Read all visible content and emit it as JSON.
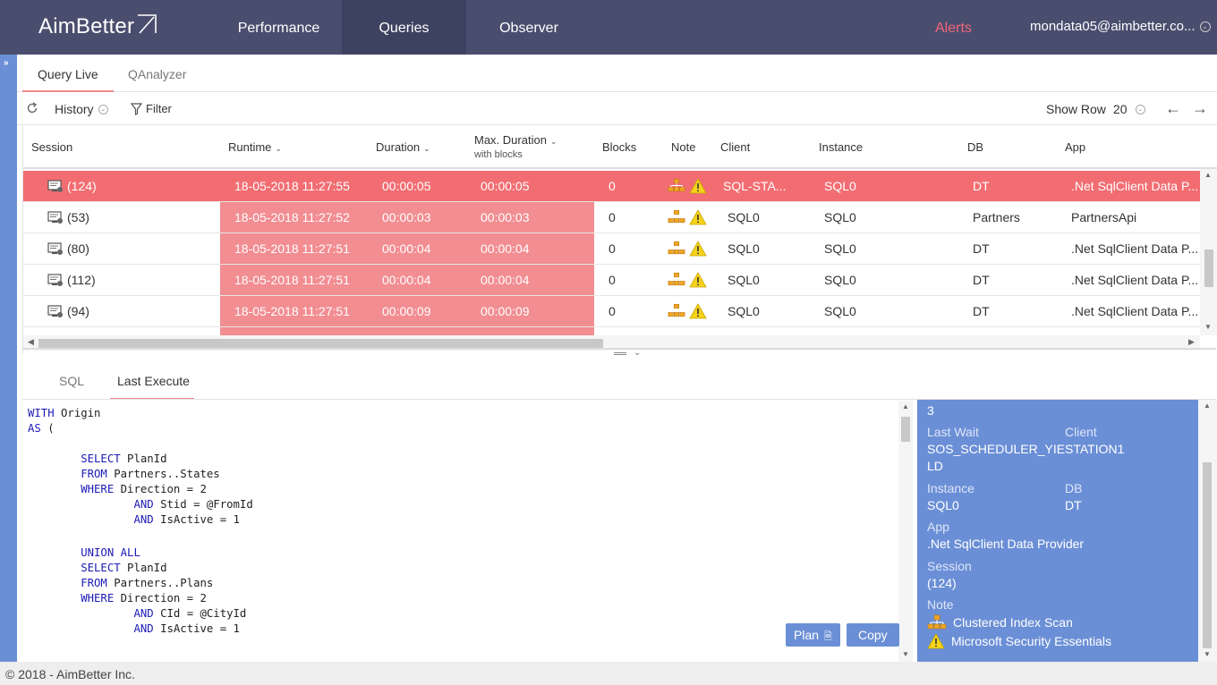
{
  "nav": {
    "logo": "AimBetter",
    "tabs": [
      "Performance",
      "Queries",
      "Observer"
    ],
    "alerts": "Alerts",
    "user": "mondata05@aimbetter.co..."
  },
  "subtabs": [
    "Query Live",
    "QAnalyzer"
  ],
  "toolbar": {
    "history": "History",
    "filter": "Filter",
    "show_row_label": "Show Row",
    "show_row_value": "20"
  },
  "columns": {
    "session": "Session",
    "runtime": "Runtime",
    "duration": "Duration",
    "max_duration": "Max. Duration",
    "max_duration_sub": "with blocks",
    "blocks": "Blocks",
    "note": "Note",
    "client": "Client",
    "instance": "Instance",
    "db": "DB",
    "app": "App"
  },
  "rows": [
    {
      "session": "(124)",
      "runtime": "18-05-2018 11:27:55",
      "duration": "00:00:05",
      "max": "00:00:05",
      "blocks": "0",
      "client": "SQL-STA...",
      "instance": "SQL0",
      "db": "DT",
      "app": ".Net SqlClient Data P..."
    },
    {
      "session": "(53)",
      "runtime": "18-05-2018 11:27:52",
      "duration": "00:00:03",
      "max": "00:00:03",
      "blocks": "0",
      "client": "SQL0",
      "instance": "SQL0",
      "db": "Partners",
      "app": "PartnersApi"
    },
    {
      "session": "(80)",
      "runtime": "18-05-2018 11:27:51",
      "duration": "00:00:04",
      "max": "00:00:04",
      "blocks": "0",
      "client": "SQL0",
      "instance": "SQL0",
      "db": "DT",
      "app": ".Net SqlClient Data P..."
    },
    {
      "session": "(112)",
      "runtime": "18-05-2018 11:27:51",
      "duration": "00:00:04",
      "max": "00:00:04",
      "blocks": "0",
      "client": "SQL0",
      "instance": "SQL0",
      "db": "DT",
      "app": ".Net SqlClient Data P..."
    },
    {
      "session": "(94)",
      "runtime": "18-05-2018 11:27:51",
      "duration": "00:00:09",
      "max": "00:00:09",
      "blocks": "0",
      "client": "SQL0",
      "instance": "SQL0",
      "db": "DT",
      "app": ".Net SqlClient Data P..."
    }
  ],
  "bottomtabs": [
    "SQL",
    "Last Execute"
  ],
  "sql_lines": [
    {
      "kw": "WITH",
      "rest": " Origin"
    },
    {
      "kw": "AS",
      "rest": " ("
    },
    {
      "kw": "",
      "rest": ""
    },
    {
      "kw": "        SELECT",
      "rest": " PlanId"
    },
    {
      "kw": "        FROM",
      "rest": " Partners..States"
    },
    {
      "kw": "        WHERE",
      "rest": " Direction = 2"
    },
    {
      "kw": "                AND",
      "rest": " Stid = @FromId"
    },
    {
      "kw": "                AND",
      "rest": " IsActive = 1"
    },
    {
      "kw": "",
      "rest": ""
    },
    {
      "kw": "        UNION ALL",
      "rest": ""
    },
    {
      "kw": "        SELECT",
      "rest": " PlanId"
    },
    {
      "kw": "        FROM",
      "rest": " Partners..Plans"
    },
    {
      "kw": "        WHERE",
      "rest": " Direction = 2"
    },
    {
      "kw": "                AND",
      "rest": " CId = @CityId"
    },
    {
      "kw": "                AND",
      "rest": " IsActive = 1"
    }
  ],
  "buttons": {
    "plan": "Plan",
    "copy": "Copy"
  },
  "details": {
    "top_value": "3",
    "last_wait_label": "Last Wait",
    "last_wait_value_1": "SOS_SCHEDULER_YIE",
    "last_wait_value_2": "LD",
    "client_label": "Client",
    "client_value": "STATION1",
    "instance_label": "Instance",
    "instance_value": "SQL0",
    "db_label": "DB",
    "db_value": "DT",
    "app_label": "App",
    "app_value": ".Net SqlClient Data Provider",
    "session_label": "Session",
    "session_value": "(124)",
    "note_label": "Note",
    "note_1": "Clustered Index Scan",
    "note_2": "Microsoft Security Essentials"
  },
  "footer": "© 2018 - AimBetter Inc.",
  "colors": {
    "nav": "#4a4e6e",
    "accent": "#6b8fd6",
    "selected_row": "#f26d72",
    "runtime_band": "#f28d92",
    "alerts": "#f2667a"
  }
}
